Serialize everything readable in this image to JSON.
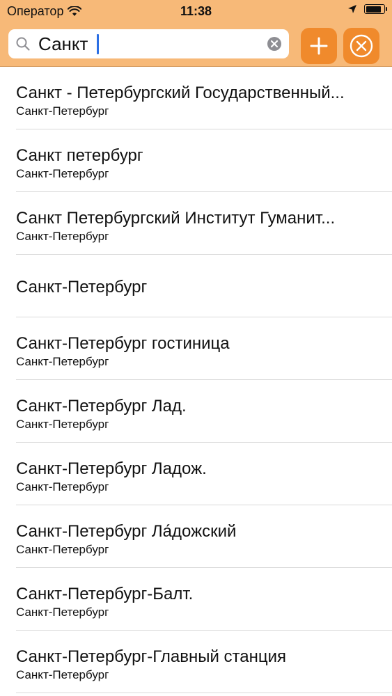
{
  "status_bar": {
    "carrier": "Оператор",
    "time": "11:38",
    "battery_level": 0.85
  },
  "search": {
    "value": "Санкт",
    "add_button": "plus-icon",
    "close_button": "close-circle-icon"
  },
  "results": [
    {
      "title": "Санкт - Петербургский Государственный...",
      "subtitle": "Санкт-Петербург"
    },
    {
      "title": "Санкт петербург",
      "subtitle": "Санкт-Петербург"
    },
    {
      "title": "Санкт Петербургский Институт Гуманит...",
      "subtitle": "Санкт-Петербург"
    },
    {
      "title": "Санкт-Петербург",
      "subtitle": ""
    },
    {
      "title": "Санкт-Петербург гостиница",
      "subtitle": "Санкт-Петербург"
    },
    {
      "title": "Санкт-Петербург Лад.",
      "subtitle": "Санкт-Петербург"
    },
    {
      "title": "Санкт-Петербург Ладож.",
      "subtitle": "Санкт-Петербург"
    },
    {
      "title": "Санкт-Петербург Ла́дожский",
      "subtitle": "Санкт-Петербург"
    },
    {
      "title": "Санкт-Петербург-Балт.",
      "subtitle": "Санкт-Петербург"
    },
    {
      "title": "Санкт-Петербург-Главный станция",
      "subtitle": "Санкт-Петербург"
    }
  ],
  "colors": {
    "header_bg": "#f7b978",
    "button_bg": "#f08a2c",
    "cursor": "#2b6fe4"
  }
}
